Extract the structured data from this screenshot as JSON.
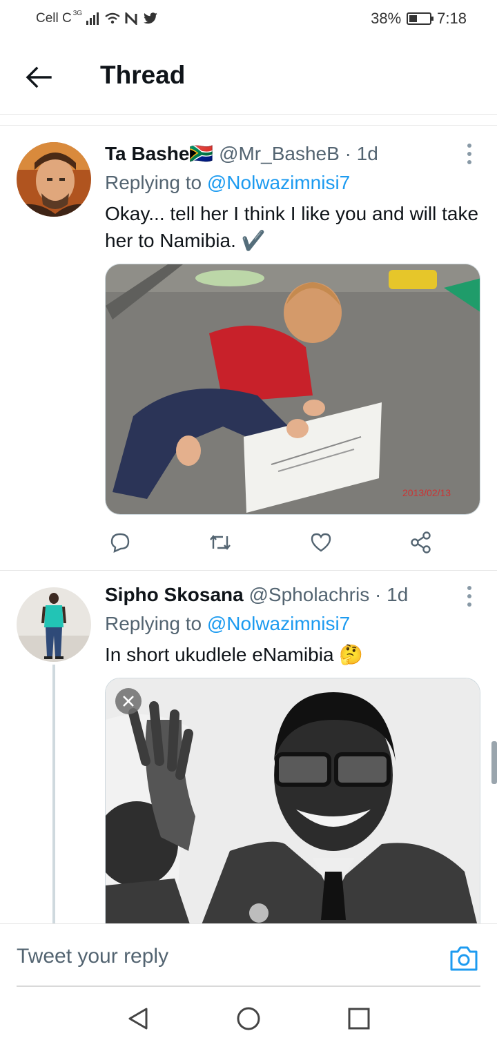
{
  "status_bar": {
    "carrier": "Cell C",
    "network": "3G",
    "battery": "38%",
    "battery_level": 0.38,
    "time": "7:18"
  },
  "header": {
    "title": "Thread",
    "back_icon": "arrow-left-icon"
  },
  "tweets": [
    {
      "name": "Ta Bashe🇿🇦",
      "handle": "@Mr_BasheB",
      "time": "· 1d",
      "replying_prefix": "Replying to ",
      "replying_to": "@Nolwazimnisi7",
      "text": "Okay... tell her I think I like you and will take her to Namibia. ✔️",
      "media_caption": "2013/02/13",
      "icons": [
        "reply-icon",
        "retweet-icon",
        "like-icon",
        "share-icon"
      ]
    },
    {
      "name": "Sipho Skosana",
      "handle": "@Spholachris",
      "time": "· 1d",
      "replying_prefix": "Replying to ",
      "replying_to": "@Nolwazimnisi7",
      "text": "In short ukudlele eNamibia 🤔"
    }
  ],
  "reply_bar": {
    "placeholder": "Tweet your reply",
    "camera_icon": "camera-icon"
  },
  "nav": {
    "icons": [
      "back-triangle-icon",
      "home-circle-icon",
      "recents-square-icon"
    ]
  },
  "colors": {
    "accent": "#1d9bf0",
    "text": "#0f1419",
    "secondary": "#536471"
  }
}
